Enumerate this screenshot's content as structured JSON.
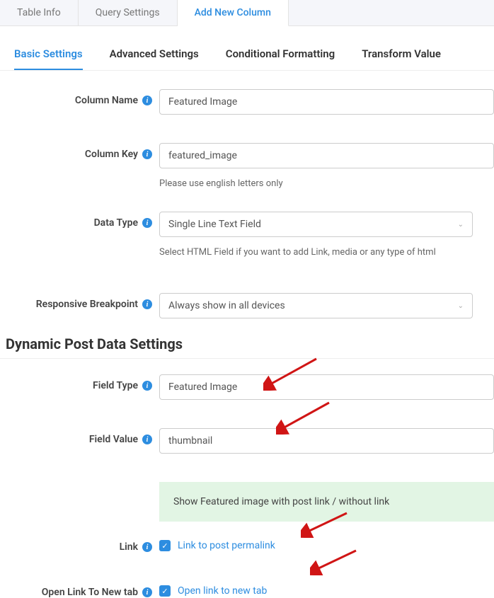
{
  "top_tabs": {
    "table_info": "Table Info",
    "query_settings": "Query Settings",
    "add_new_column": "Add New Column"
  },
  "sub_tabs": {
    "basic": "Basic Settings",
    "advanced": "Advanced Settings",
    "conditional": "Conditional Formatting",
    "transform": "Transform Value"
  },
  "column_name": {
    "label": "Column Name",
    "value": "Featured Image"
  },
  "column_key": {
    "label": "Column Key",
    "value": "featured_image",
    "help": "Please use english letters only"
  },
  "data_type": {
    "label": "Data Type",
    "value": "Single Line Text Field",
    "help": "Select HTML Field if you want to add Link, media or any type of html"
  },
  "responsive_breakpoint": {
    "label": "Responsive Breakpoint",
    "value": "Always show in all devices"
  },
  "dynamic_section": {
    "title": "Dynamic Post Data Settings"
  },
  "field_type": {
    "label": "Field Type",
    "value": "Featured Image"
  },
  "field_value": {
    "label": "Field Value",
    "value": "thumbnail"
  },
  "info_banner": "Show Featured image with post link / without link",
  "link": {
    "label": "Link",
    "checkbox_label": "Link to post permalink"
  },
  "open_new_tab": {
    "label": "Open Link To New tab",
    "checkbox_label": "Open link to new tab"
  }
}
